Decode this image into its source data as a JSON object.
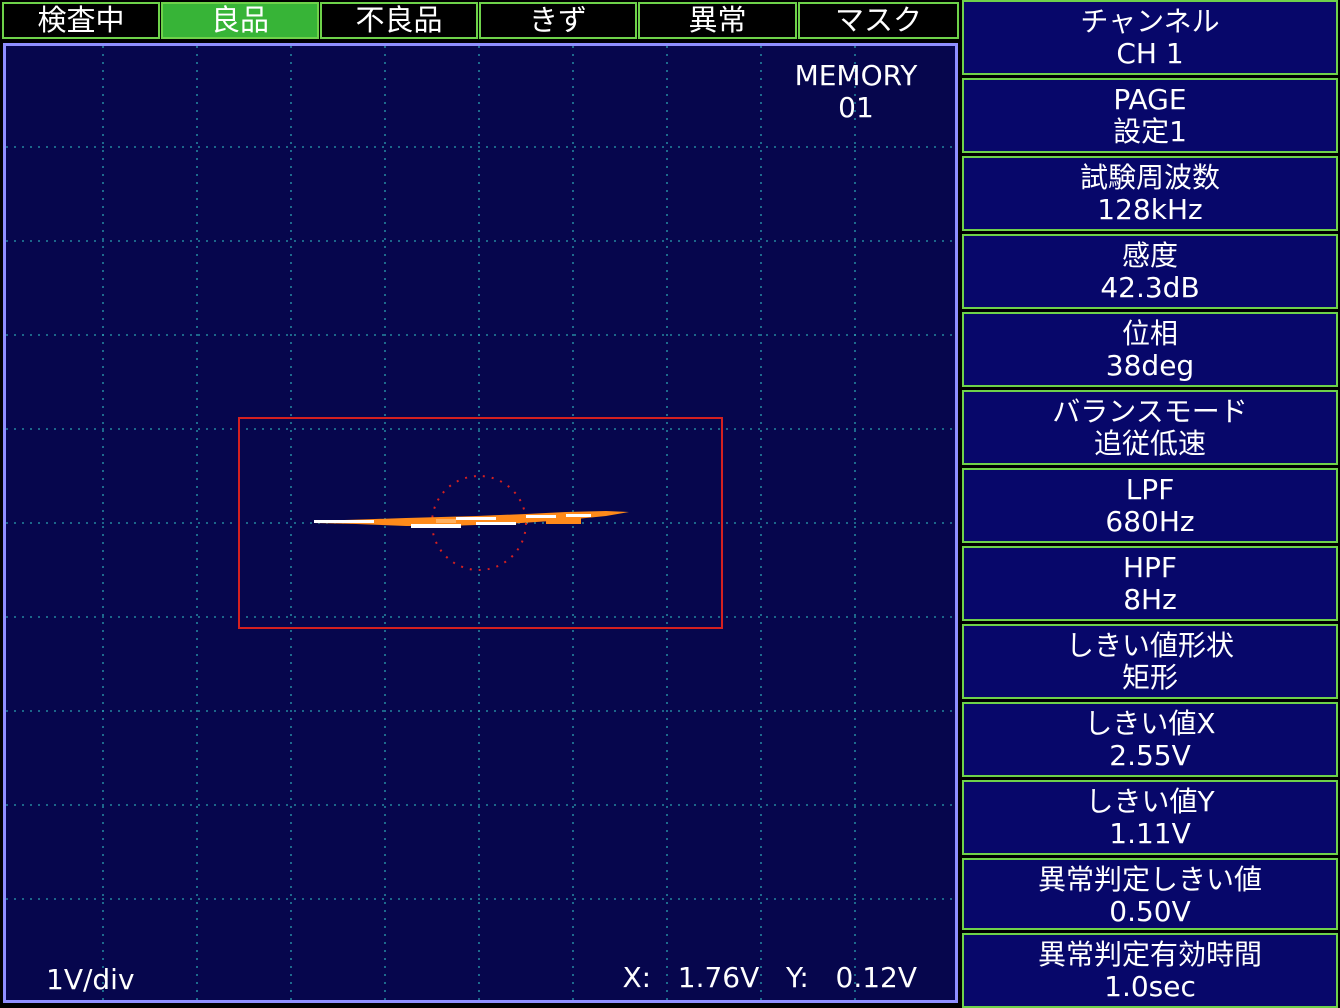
{
  "tabs": [
    {
      "label": "検査中",
      "active": false
    },
    {
      "label": "良品",
      "active": true
    },
    {
      "label": "不良品",
      "active": false
    },
    {
      "label": "きず",
      "active": false
    },
    {
      "label": "異常",
      "active": false
    },
    {
      "label": "マスク",
      "active": false
    }
  ],
  "scope": {
    "memory_label": "MEMORY",
    "memory_number": "01",
    "scale": "1V/div",
    "x_label": "X:",
    "x_value": "1.76V",
    "y_label": "Y:",
    "y_value": "0.12V"
  },
  "menu": [
    {
      "title": "チャンネル",
      "value": "CH 1"
    },
    {
      "title": "PAGE",
      "value": "設定1"
    },
    {
      "title": "試験周波数",
      "value": "128kHz"
    },
    {
      "title": "感度",
      "value": "42.3dB"
    },
    {
      "title": "位相",
      "value": "38deg"
    },
    {
      "title": "バランスモード",
      "value": "追従低速"
    },
    {
      "title": "LPF",
      "value": "680Hz"
    },
    {
      "title": "HPF",
      "value": "8Hz"
    },
    {
      "title": "しきい値形状",
      "value": "矩形"
    },
    {
      "title": "しきい値X",
      "value": "2.55V"
    },
    {
      "title": "しきい値Y",
      "value": "1.11V"
    },
    {
      "title": "異常判定しきい値",
      "value": "0.50V"
    },
    {
      "title": "異常判定有効時間",
      "value": "1.0sec"
    }
  ],
  "colors": {
    "background": "#06064d",
    "grid": "#2a9fb0",
    "threshold_box": "#d42020",
    "signal_primary": "#ff8a1a",
    "signal_secondary": "#ffffff",
    "tab_border": "#6ed24a",
    "tab_active": "#37b437"
  }
}
